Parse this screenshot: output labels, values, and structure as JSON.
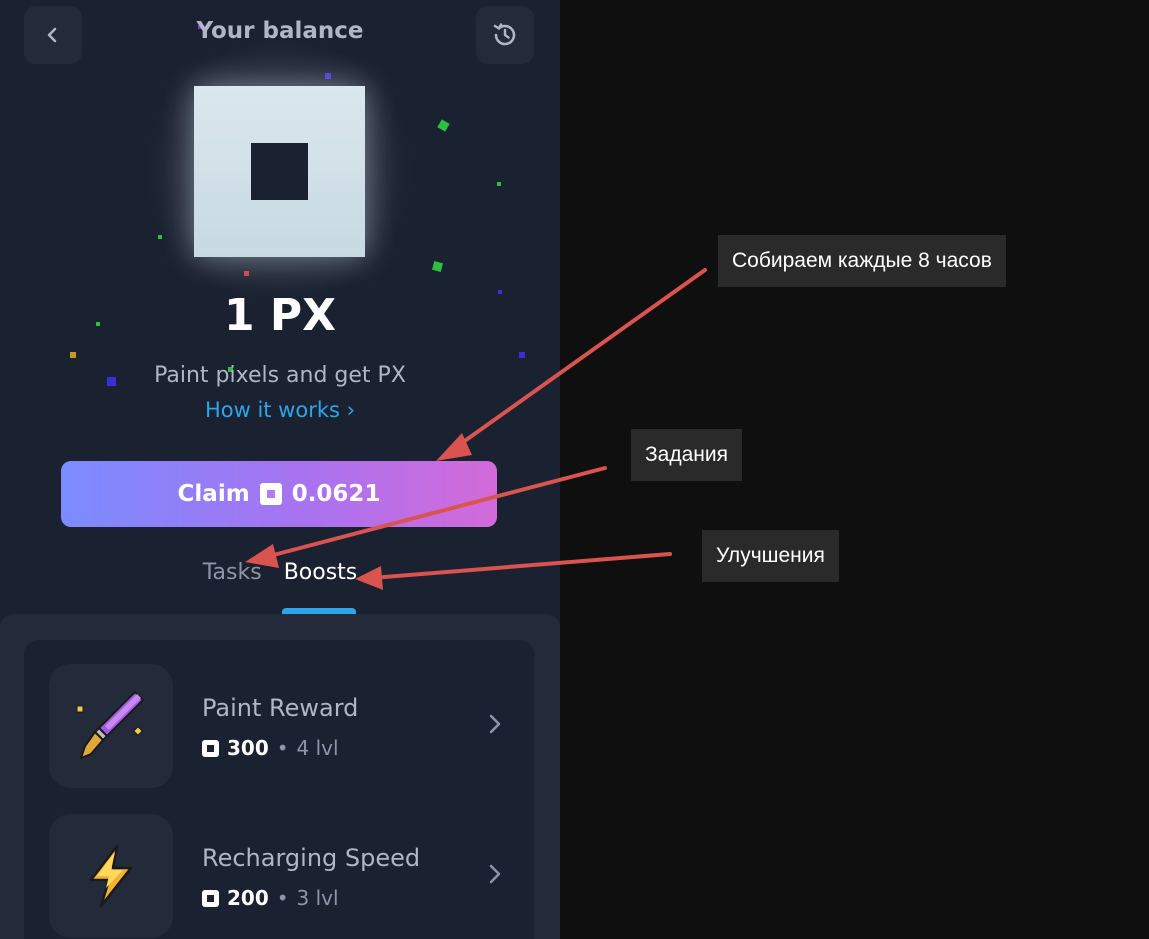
{
  "header": {
    "title": "Your balance",
    "back_icon": "chevron-left-icon",
    "history_icon": "history-icon"
  },
  "balance": {
    "amount": "1 PX",
    "subtitle": "Paint pixels and get PX",
    "how_link": "How it works ›"
  },
  "claim": {
    "label": "Claim",
    "amount": "0.0621"
  },
  "tabs": {
    "tasks": "Tasks",
    "boosts": "Boosts",
    "active": "Boosts"
  },
  "boosts": [
    {
      "name": "Paint Reward",
      "cost": "300",
      "level": "4 lvl",
      "icon": "paintbrush-icon"
    },
    {
      "name": "Recharging Speed",
      "cost": "200",
      "level": "3 lvl",
      "icon": "lightning-icon"
    }
  ],
  "annotations": {
    "collect": "Собираем каждые 8 часов",
    "tasks": "Задания",
    "boosts": "Улучшения"
  },
  "colors": {
    "accent_blue": "#2ea5ea",
    "claim_gradient_start": "#7b8cff",
    "claim_gradient_end": "#d36ad9",
    "annotation_arrow": "#d9534f"
  }
}
